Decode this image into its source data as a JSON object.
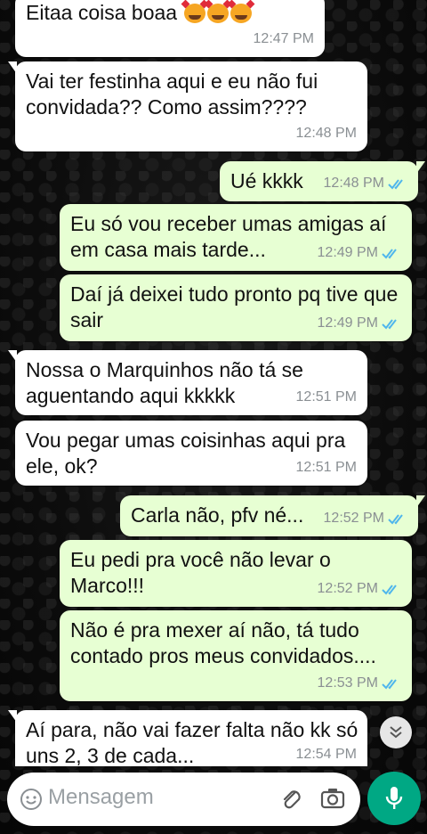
{
  "messages": [
    {
      "text": "Eitaa coisa boaa",
      "time": "12:47 PM",
      "direction": "in"
    },
    {
      "text": "Vai ter festinha aqui e eu não fui convidada?? Como assim????",
      "time": "12:48 PM",
      "direction": "in"
    },
    {
      "text": "Ué kkkk",
      "time": "12:48 PM",
      "direction": "out"
    },
    {
      "text": "Eu só vou receber umas amigas aí em casa mais tarde...",
      "time": "12:49 PM",
      "direction": "out"
    },
    {
      "text": "Daí já deixei tudo pronto pq tive que sair",
      "time": "12:49 PM",
      "direction": "out"
    },
    {
      "text": "Nossa o Marquinhos não tá se aguentando aqui kkkkk",
      "time": "12:51 PM",
      "direction": "in"
    },
    {
      "text": "Vou pegar umas coisinhas aqui pra ele, ok?",
      "time": "12:51 PM",
      "direction": "in"
    },
    {
      "text": "Carla não, pfv né...",
      "time": "12:52 PM",
      "direction": "out"
    },
    {
      "text": "Eu pedi pra você não levar o Marco!!!",
      "time": "12:52 PM",
      "direction": "out"
    },
    {
      "text": "Não é pra mexer aí não, tá tudo contado pros meus convidados....",
      "time": "12:53 PM",
      "direction": "out"
    },
    {
      "text": "Aí para, não vai fazer falta não kk só uns 2, 3 de cada...",
      "time": "12:54 PM",
      "direction": "in"
    }
  ],
  "composer": {
    "placeholder": "Mensagem"
  },
  "icons": {
    "emoji": "emoji-icon",
    "attach": "paperclip-icon",
    "camera": "camera-icon",
    "mic": "microphone-icon",
    "scroll": "chevron-double-down-icon",
    "read_receipt": "double-check-icon"
  },
  "colors": {
    "incoming_bubble": "#ffffff",
    "outgoing_bubble": "#e7ffd3",
    "read_tick": "#4fb6ec",
    "accent": "#00a884"
  }
}
